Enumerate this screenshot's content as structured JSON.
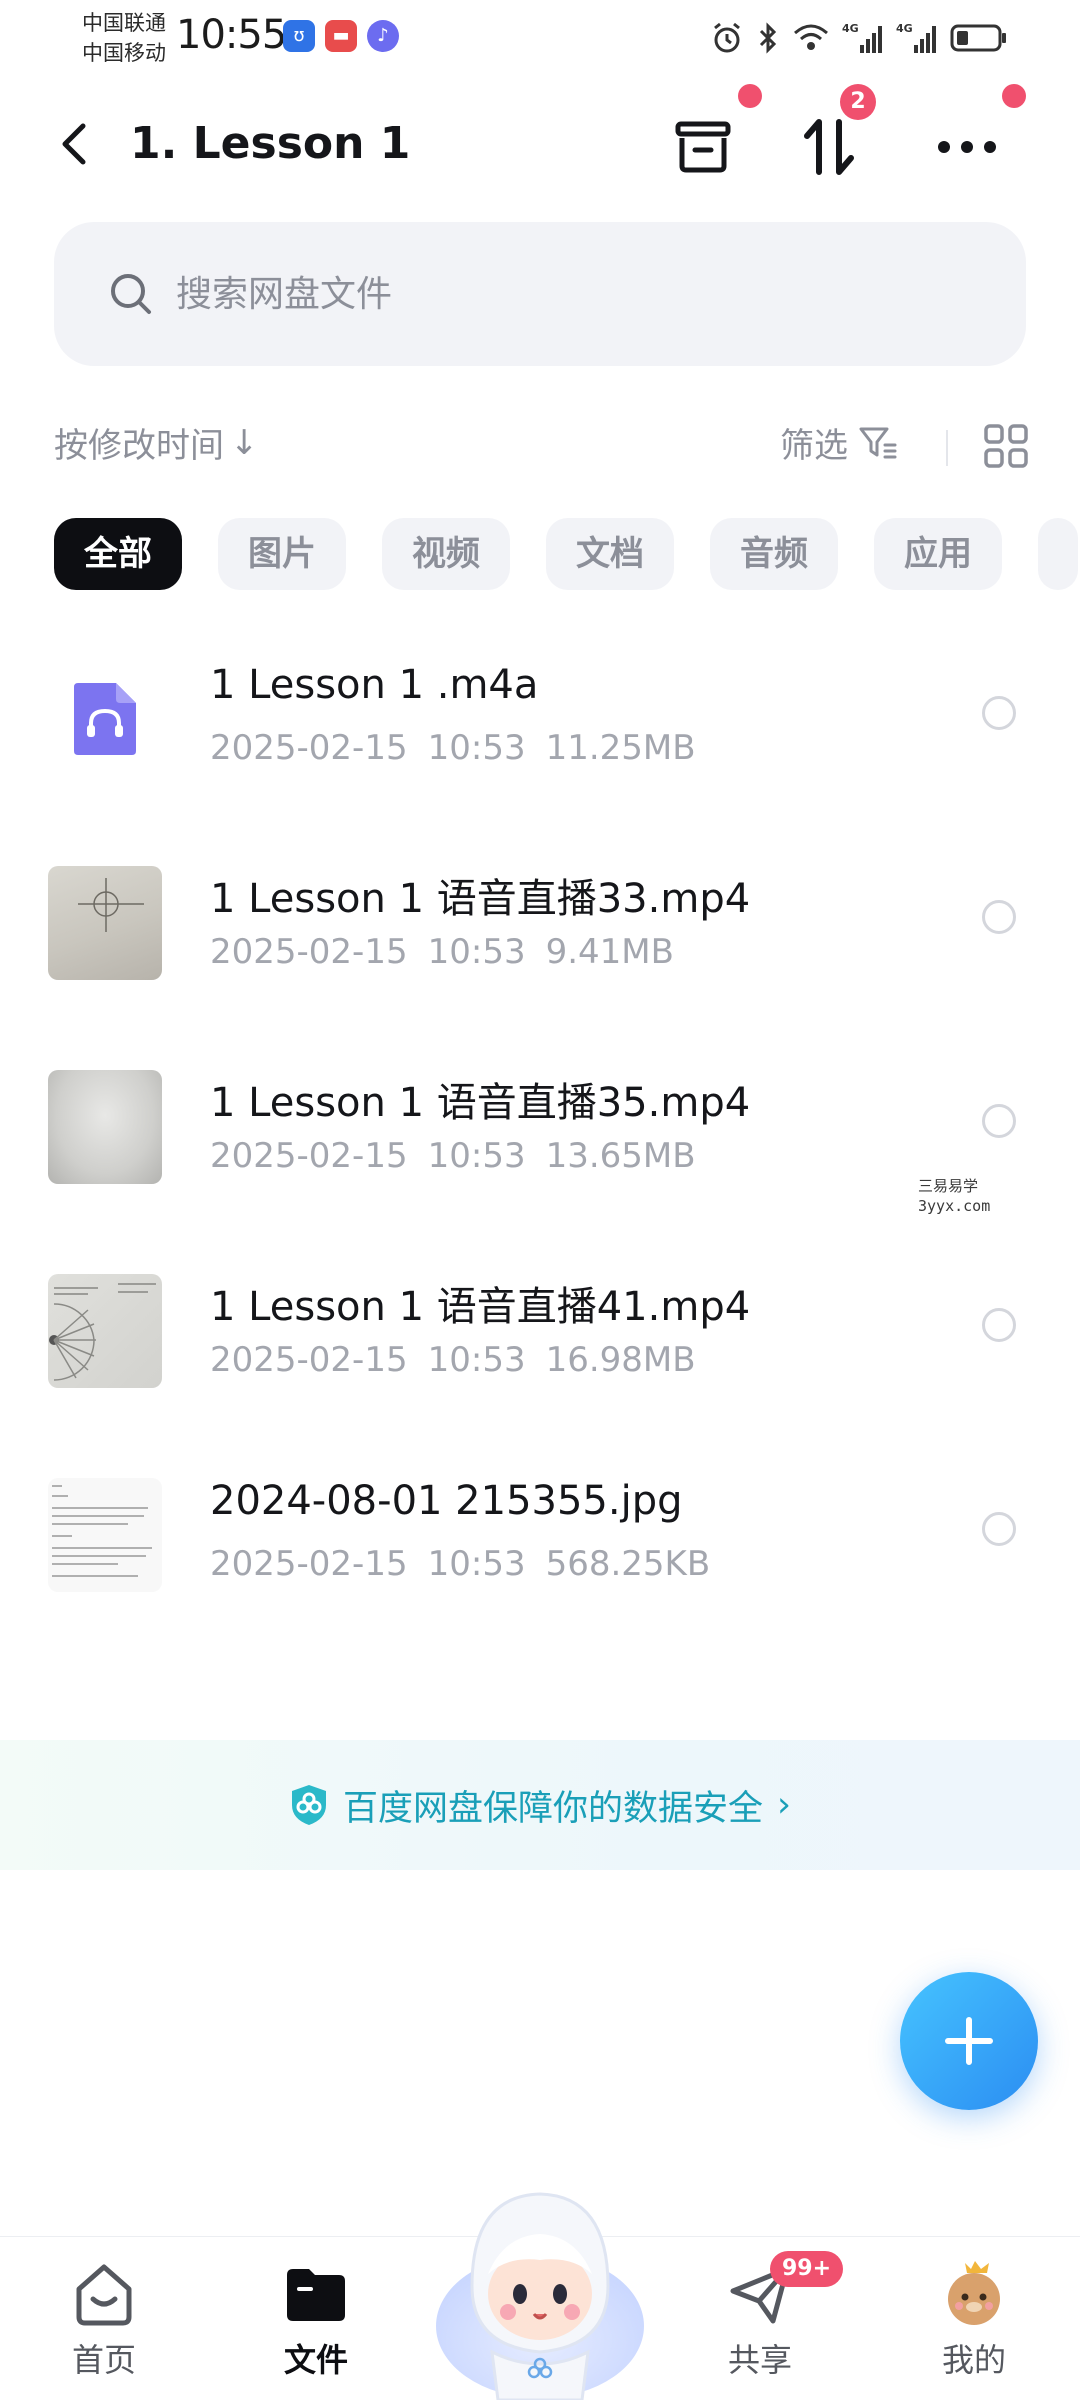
{
  "status_bar": {
    "carrier_1": "中国联通",
    "carrier_2": "中国移动",
    "time": "10:55",
    "signal_label_1": "4G",
    "signal_label_2": "4G"
  },
  "header": {
    "title": "1. Lesson 1",
    "transfer_count": "2"
  },
  "search": {
    "placeholder": "搜索网盘文件"
  },
  "sort_bar": {
    "sort_label": "按修改时间",
    "sort_arrow": "↓",
    "filter_label": "筛选"
  },
  "tabs": [
    {
      "label": "全部",
      "active": true
    },
    {
      "label": "图片",
      "active": false
    },
    {
      "label": "视频",
      "active": false
    },
    {
      "label": "文档",
      "active": false
    },
    {
      "label": "音频",
      "active": false
    },
    {
      "label": "应用",
      "active": false
    }
  ],
  "files": [
    {
      "name": "1 Lesson 1 .m4a",
      "date": "2025-02-15",
      "time": "10:53",
      "size": "11.25MB",
      "thumb": "audio-file-icon"
    },
    {
      "name": "1 Lesson 1 语音直播33.mp4",
      "date": "2025-02-15",
      "time": "10:53",
      "size": "9.41MB",
      "thumb": "video-thumbnail"
    },
    {
      "name": "1 Lesson 1 语音直播35.mp4",
      "date": "2025-02-15",
      "time": "10:53",
      "size": "13.65MB",
      "thumb": "video-thumbnail"
    },
    {
      "name": "1 Lesson 1 语音直播41.mp4",
      "date": "2025-02-15",
      "time": "10:53",
      "size": "16.98MB",
      "thumb": "video-thumbnail"
    },
    {
      "name": "2024-08-01 215355.jpg",
      "date": "2025-02-15",
      "time": "10:53",
      "size": "568.25KB",
      "thumb": "image-thumbnail"
    }
  ],
  "security_banner": {
    "text": "百度网盘保障你的数据安全",
    "chevron": "›"
  },
  "bottom_nav": [
    {
      "label": "首页",
      "icon": "home-icon",
      "active": false
    },
    {
      "label": "文件",
      "icon": "folder-icon",
      "active": true
    },
    {
      "label": "共享",
      "icon": "share-icon",
      "active": false,
      "badge": "99+"
    },
    {
      "label": "我的",
      "icon": "profile-icon",
      "active": false
    }
  ],
  "watermark": {
    "line_1": "三易易学",
    "line_2": "3yyx.com"
  },
  "colors": {
    "accent_blue": "#2b8df2",
    "badge_red": "#f0506e",
    "active_tab": "#0d0e12",
    "security_text": "#1a9fb8"
  }
}
